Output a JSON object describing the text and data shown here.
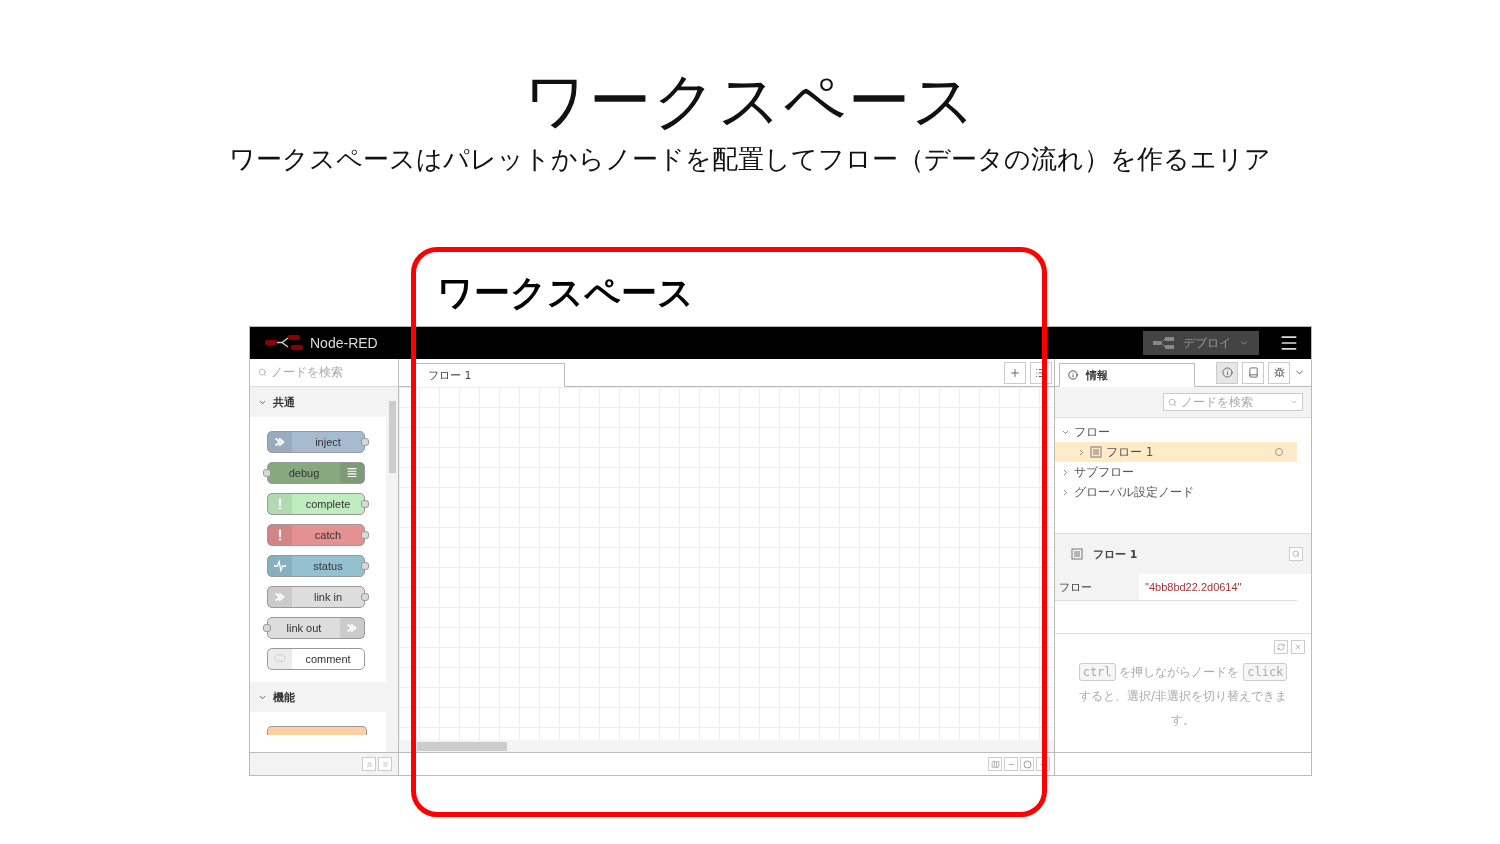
{
  "slide": {
    "title": "ワークスペース",
    "subtitle": "ワークスペースはパレットからノードを配置してフロー（データの流れ）を作るエリア",
    "highlight_label": "ワークスペース"
  },
  "header": {
    "brand": "Node-RED",
    "deploy_label": "デプロイ"
  },
  "palette": {
    "search_placeholder": "ノードを検索",
    "categories": [
      {
        "label": "共通",
        "expanded": true,
        "nodes": [
          {
            "label": "inject",
            "kind": "source",
            "color": "#a6bbcf"
          },
          {
            "label": "debug",
            "kind": "sink",
            "color": "#87a980"
          },
          {
            "label": "complete",
            "kind": "source",
            "color": "#c0edc0"
          },
          {
            "label": "catch",
            "kind": "source",
            "color": "#e49191"
          },
          {
            "label": "status",
            "kind": "source",
            "color": "#94c1d0"
          },
          {
            "label": "link in",
            "kind": "source",
            "color": "#dddddd"
          },
          {
            "label": "link out",
            "kind": "sink",
            "color": "#dddddd"
          },
          {
            "label": "comment",
            "kind": "note",
            "color": "#ffffff"
          }
        ]
      },
      {
        "label": "機能",
        "expanded": true,
        "nodes": [
          {
            "kind": "peek",
            "color": "#fdd0a2"
          }
        ]
      }
    ]
  },
  "workspace": {
    "tabs": [
      {
        "label": "フロー 1",
        "selected": true
      }
    ]
  },
  "sidebar": {
    "tabs": [
      {
        "label": "情報",
        "selected": true
      }
    ],
    "search_placeholder": "ノードを検索",
    "tree": [
      {
        "label": "フロー",
        "expanded": true,
        "children": [
          {
            "label": "フロー 1",
            "selected": true
          }
        ]
      },
      {
        "label": "サブフロー",
        "expanded": false
      },
      {
        "label": "グローバル設定ノード",
        "expanded": false
      }
    ],
    "info": {
      "title": "フロー 1",
      "rows": [
        {
          "key": "フロー",
          "value": "\"4bb8bd22.2d0614\""
        }
      ]
    },
    "tip": {
      "key1": "ctrl",
      "text1": "を押しながらノードを",
      "key2": "click",
      "text2": "すると、選択/非選択を切り替えできます。"
    }
  }
}
